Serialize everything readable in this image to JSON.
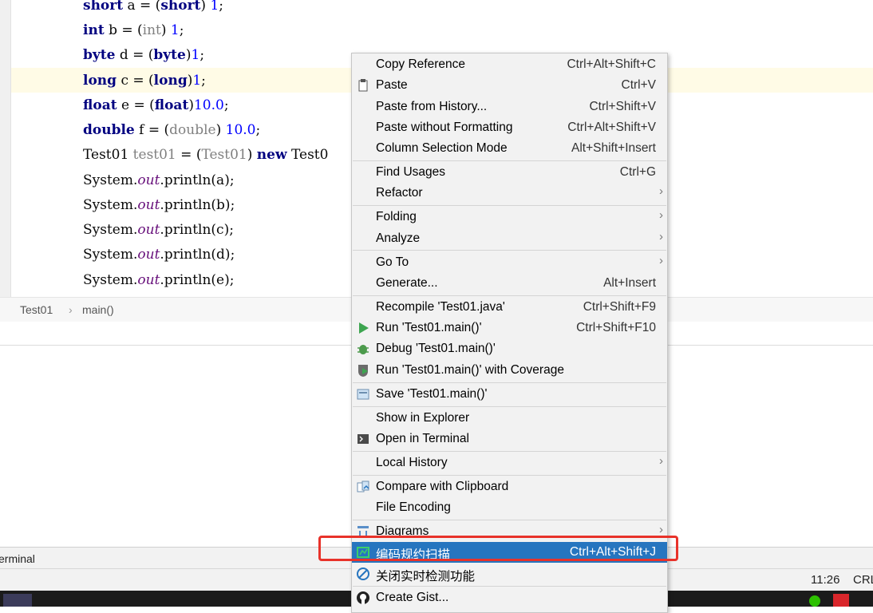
{
  "editor": {
    "lines": [
      [
        "short",
        " a = (",
        "short",
        ") ",
        "1",
        ";"
      ],
      [
        "int",
        " b = (",
        "int",
        ") ",
        "1",
        ";"
      ],
      [
        "byte",
        " d = (",
        "byte",
        ")",
        "1",
        ";"
      ],
      [
        "long",
        " c = (",
        "long",
        ")",
        "1",
        ";"
      ],
      [
        "float",
        " e = (",
        "float",
        ")",
        "10.0",
        ";"
      ],
      [
        "double",
        " f = (",
        "double",
        ") ",
        "10.0",
        ";"
      ]
    ],
    "test_line": {
      "type": "Test01 ",
      "var": "test01",
      "eq": " = (",
      "cast": "Test01",
      "rest": ") ",
      "kw": "new",
      "after": " Test0"
    },
    "print_lines": [
      {
        "a": "System.",
        "f": "out",
        "b": ".println(a);"
      },
      {
        "a": "System.",
        "f": "out",
        "b": ".println(b);"
      },
      {
        "a": "System.",
        "f": "out",
        "b": ".println(c);"
      },
      {
        "a": "System.",
        "f": "out",
        "b": ".println(d);"
      },
      {
        "a": "System.",
        "f": "out",
        "b": ".println(e);"
      }
    ]
  },
  "breadcrumb": {
    "class": "Test01",
    "sep": "›",
    "method": "main()"
  },
  "tool_tab": "erminal",
  "status": {
    "time": "11:26",
    "sep": "CRL"
  },
  "context_menu": {
    "items": [
      {
        "label": "Copy Reference",
        "shortcut": "Ctrl+Alt+Shift+C"
      },
      {
        "label": "Paste",
        "shortcut": "Ctrl+V",
        "icon": "clipboard-icon"
      },
      {
        "label": "Paste from History...",
        "shortcut": "Ctrl+Shift+V"
      },
      {
        "label": "Paste without Formatting",
        "shortcut": "Ctrl+Alt+Shift+V"
      },
      {
        "label": "Column Selection Mode",
        "shortcut": "Alt+Shift+Insert"
      },
      {
        "label": "Find Usages",
        "shortcut": "Ctrl+G"
      },
      {
        "label": "Refactor",
        "shortcut": ""
      },
      {
        "label": "Folding",
        "shortcut": ""
      },
      {
        "label": "Analyze",
        "shortcut": ""
      },
      {
        "label": "Go To",
        "shortcut": ""
      },
      {
        "label": "Generate...",
        "shortcut": "Alt+Insert"
      },
      {
        "label": "Recompile 'Test01.java'",
        "shortcut": "Ctrl+Shift+F9"
      },
      {
        "label": "Run 'Test01.main()'",
        "shortcut": "Ctrl+Shift+F10",
        "icon": "run-icon"
      },
      {
        "label": "Debug 'Test01.main()'",
        "shortcut": "",
        "icon": "debug-icon"
      },
      {
        "label": "Run 'Test01.main()' with Coverage",
        "shortcut": "",
        "icon": "coverage-icon"
      },
      {
        "label": "Save 'Test01.main()'",
        "shortcut": "",
        "icon": "save-config-icon"
      },
      {
        "label": "Show in Explorer",
        "shortcut": ""
      },
      {
        "label": "Open in Terminal",
        "shortcut": "",
        "icon": "terminal-icon"
      },
      {
        "label": "Local History",
        "shortcut": ""
      },
      {
        "label": "Compare with Clipboard",
        "shortcut": "",
        "icon": "compare-icon"
      },
      {
        "label": "File Encoding",
        "shortcut": ""
      },
      {
        "label": "Diagrams",
        "shortcut": "",
        "icon": "diagram-icon"
      },
      {
        "label": "编码规约扫描",
        "shortcut": "Ctrl+Alt+Shift+J",
        "icon": "scan-icon"
      },
      {
        "label": "关闭实时检测功能",
        "shortcut": "",
        "icon": "forbid-icon"
      },
      {
        "label": "Create Gist...",
        "shortcut": "",
        "icon": "github-icon"
      }
    ],
    "submenu_arrow": "›"
  },
  "colors": {
    "selection": "#2675bf",
    "highlight_box": "#e8322a",
    "keyword": "#000080",
    "number": "#0000ff"
  }
}
